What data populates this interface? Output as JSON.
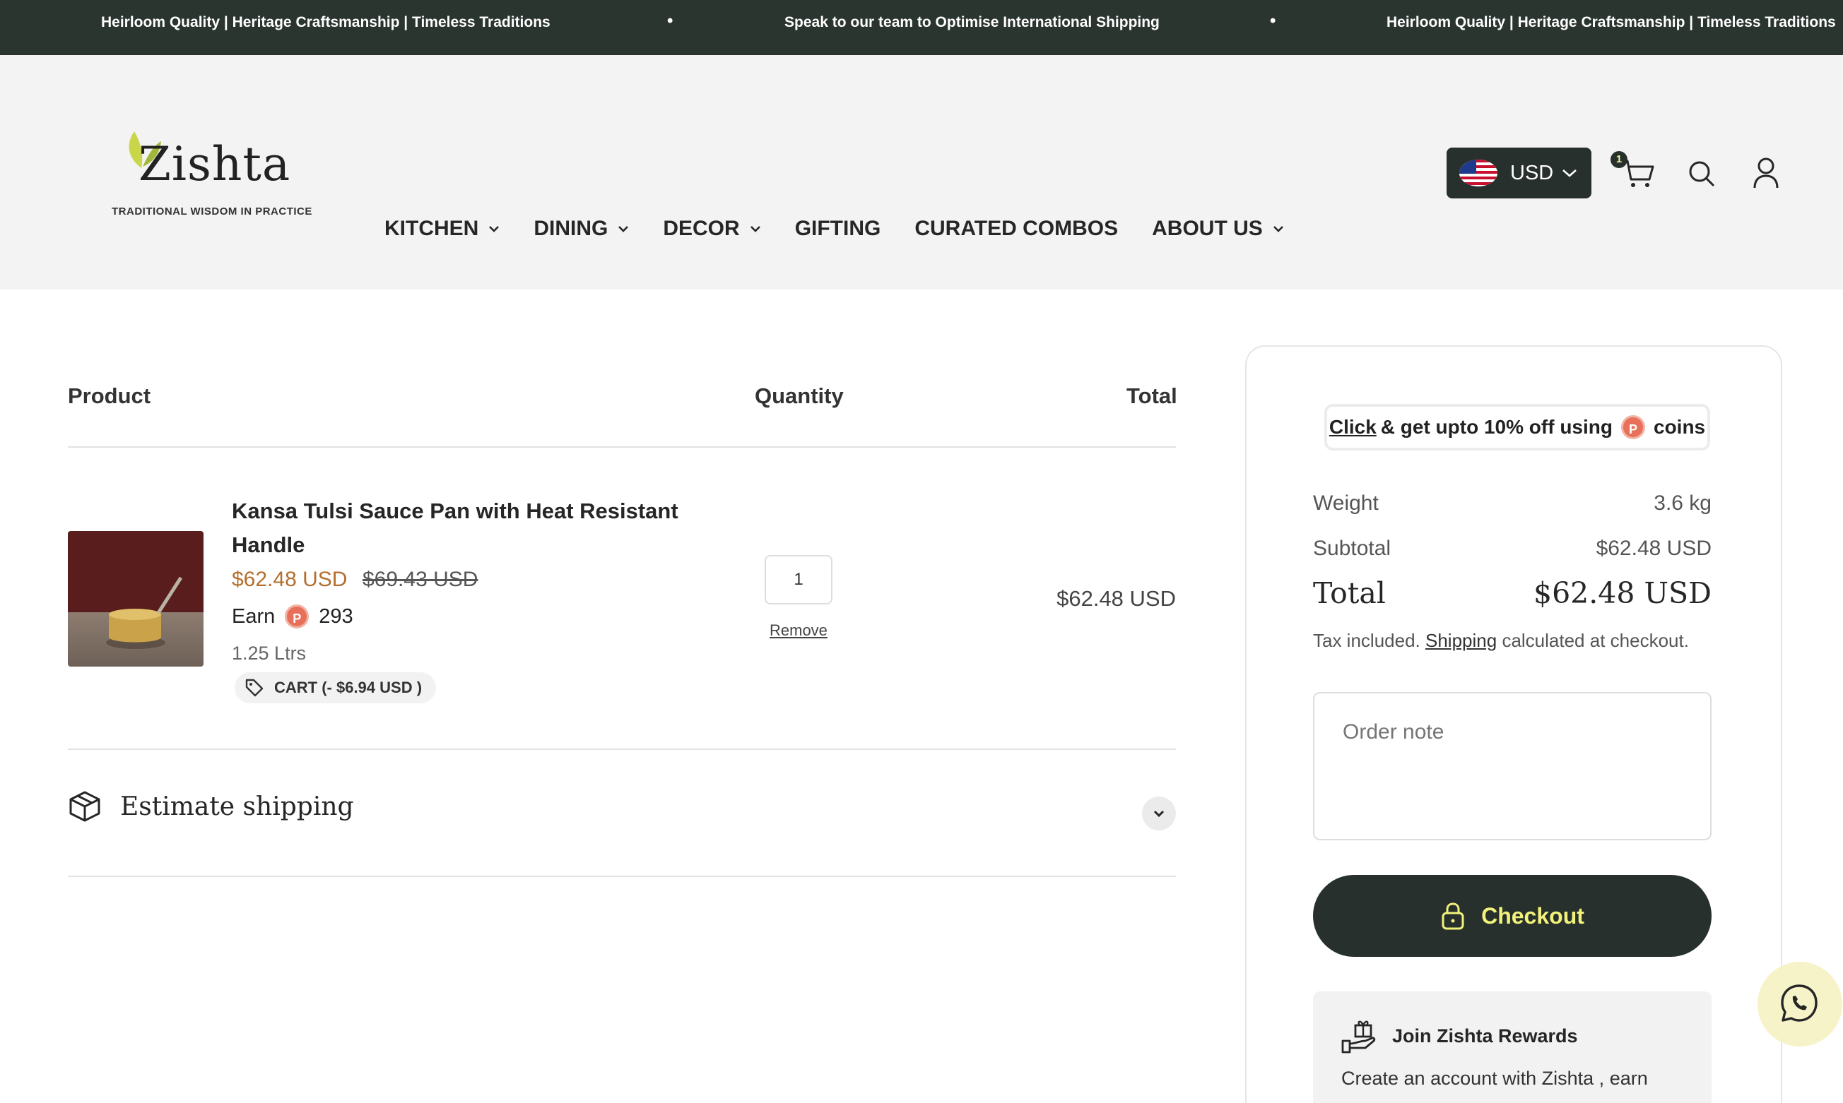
{
  "announcement": {
    "messages": [
      "Heirloom Quality | Heritage Craftsmanship | Timeless Traditions",
      "Speak to our team to Optimise International Shipping",
      "Heirloom Quality | Heritage Craftsmanship | Timeless Traditions"
    ],
    "separator": "•"
  },
  "header": {
    "logo_text": "Zishta",
    "logo_tagline": "TRADITIONAL WISDOM IN PRACTICE",
    "nav": [
      {
        "label": "KITCHEN",
        "dropdown": true
      },
      {
        "label": "DINING",
        "dropdown": true
      },
      {
        "label": "DECOR",
        "dropdown": true
      },
      {
        "label": "GIFTING",
        "dropdown": false
      },
      {
        "label": "CURATED COMBOS",
        "dropdown": false
      },
      {
        "label": "ABOUT US",
        "dropdown": true
      }
    ],
    "currency": "USD",
    "cart_count": "1"
  },
  "cart": {
    "headers": {
      "product": "Product",
      "quantity": "Quantity",
      "total": "Total"
    },
    "item": {
      "title": "Kansa Tulsi Sauce Pan with Heat Resistant Handle",
      "price": "$62.48 USD",
      "compare_price": "$69.43 USD",
      "earn_label": "Earn",
      "earn_points": "293",
      "variant": "1.25 Ltrs",
      "discount_label": "CART (-  $6.94 USD  )",
      "quantity": "1",
      "remove_label": "Remove",
      "line_total": "$62.48 USD"
    },
    "estimate_shipping": "Estimate shipping"
  },
  "summary": {
    "promo_click": "Click",
    "promo_text": "& get upto 10% off using",
    "promo_coins": "coins",
    "weight_label": "Weight",
    "weight_value": "3.6 kg",
    "subtotal_label": "Subtotal",
    "subtotal_value": "$62.48 USD",
    "total_label": "Total",
    "total_value": "$62.48 USD",
    "tax_prefix": "Tax included.",
    "tax_link": "Shipping",
    "tax_suffix": "calculated at checkout.",
    "order_note_placeholder": "Order note",
    "checkout_label": "Checkout",
    "rewards_title": "Join Zishta Rewards",
    "rewards_desc": "Create an account with Zishta , earn"
  },
  "colors": {
    "dark_green": "#27302c",
    "accent_yellow": "#f2f27a",
    "price_orange": "#b36f2e",
    "coin_red": "#e8705a"
  }
}
